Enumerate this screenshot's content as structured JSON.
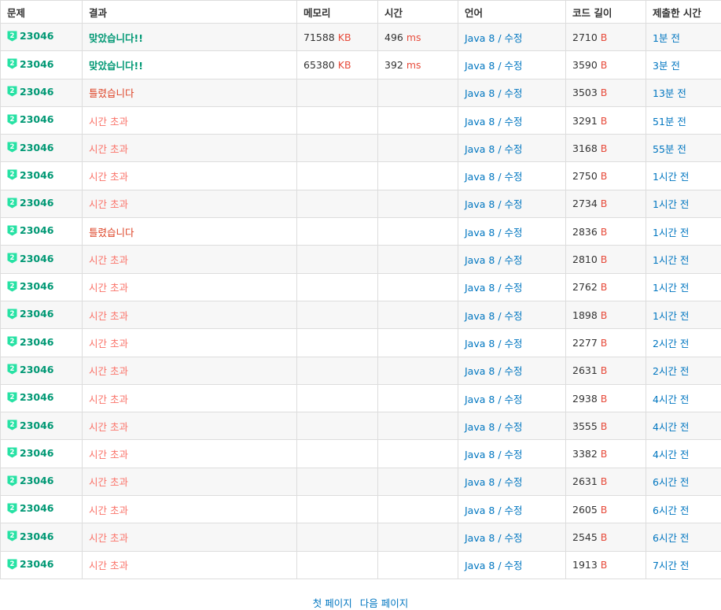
{
  "headers": [
    "문제",
    "결과",
    "메모리",
    "시간",
    "언어",
    "코드 길이",
    "제출한 시간"
  ],
  "units": {
    "memory": "KB",
    "time": "ms",
    "code": "B"
  },
  "language_separator": " / ",
  "tier_icon": {
    "name": "gold-tier-icon",
    "label": "2",
    "color": "#27e2a4"
  },
  "colors": {
    "accepted": "#009874",
    "wrong": "#dd4124",
    "tle": "#fa7268",
    "link": "#0076c0",
    "unit": "#e74c3c"
  },
  "rows": [
    {
      "problem": "23046",
      "result": "맞았습니다!!",
      "result_type": "ac",
      "memory": "71588",
      "time": "496",
      "language": "Java 8",
      "edit": "수정",
      "code_length": "2710",
      "submitted": "1분 전"
    },
    {
      "problem": "23046",
      "result": "맞았습니다!!",
      "result_type": "ac",
      "memory": "65380",
      "time": "392",
      "language": "Java 8",
      "edit": "수정",
      "code_length": "3590",
      "submitted": "3분 전"
    },
    {
      "problem": "23046",
      "result": "틀렸습니다",
      "result_type": "wa",
      "memory": "",
      "time": "",
      "language": "Java 8",
      "edit": "수정",
      "code_length": "3503",
      "submitted": "13분 전"
    },
    {
      "problem": "23046",
      "result": "시간 초과",
      "result_type": "tle",
      "memory": "",
      "time": "",
      "language": "Java 8",
      "edit": "수정",
      "code_length": "3291",
      "submitted": "51분 전"
    },
    {
      "problem": "23046",
      "result": "시간 초과",
      "result_type": "tle",
      "memory": "",
      "time": "",
      "language": "Java 8",
      "edit": "수정",
      "code_length": "3168",
      "submitted": "55분 전"
    },
    {
      "problem": "23046",
      "result": "시간 초과",
      "result_type": "tle",
      "memory": "",
      "time": "",
      "language": "Java 8",
      "edit": "수정",
      "code_length": "2750",
      "submitted": "1시간 전"
    },
    {
      "problem": "23046",
      "result": "시간 초과",
      "result_type": "tle",
      "memory": "",
      "time": "",
      "language": "Java 8",
      "edit": "수정",
      "code_length": "2734",
      "submitted": "1시간 전"
    },
    {
      "problem": "23046",
      "result": "틀렸습니다",
      "result_type": "wa",
      "memory": "",
      "time": "",
      "language": "Java 8",
      "edit": "수정",
      "code_length": "2836",
      "submitted": "1시간 전"
    },
    {
      "problem": "23046",
      "result": "시간 초과",
      "result_type": "tle",
      "memory": "",
      "time": "",
      "language": "Java 8",
      "edit": "수정",
      "code_length": "2810",
      "submitted": "1시간 전"
    },
    {
      "problem": "23046",
      "result": "시간 초과",
      "result_type": "tle",
      "memory": "",
      "time": "",
      "language": "Java 8",
      "edit": "수정",
      "code_length": "2762",
      "submitted": "1시간 전"
    },
    {
      "problem": "23046",
      "result": "시간 초과",
      "result_type": "tle",
      "memory": "",
      "time": "",
      "language": "Java 8",
      "edit": "수정",
      "code_length": "1898",
      "submitted": "1시간 전"
    },
    {
      "problem": "23046",
      "result": "시간 초과",
      "result_type": "tle",
      "memory": "",
      "time": "",
      "language": "Java 8",
      "edit": "수정",
      "code_length": "2277",
      "submitted": "2시간 전"
    },
    {
      "problem": "23046",
      "result": "시간 초과",
      "result_type": "tle",
      "memory": "",
      "time": "",
      "language": "Java 8",
      "edit": "수정",
      "code_length": "2631",
      "submitted": "2시간 전"
    },
    {
      "problem": "23046",
      "result": "시간 초과",
      "result_type": "tle",
      "memory": "",
      "time": "",
      "language": "Java 8",
      "edit": "수정",
      "code_length": "2938",
      "submitted": "4시간 전"
    },
    {
      "problem": "23046",
      "result": "시간 초과",
      "result_type": "tle",
      "memory": "",
      "time": "",
      "language": "Java 8",
      "edit": "수정",
      "code_length": "3555",
      "submitted": "4시간 전"
    },
    {
      "problem": "23046",
      "result": "시간 초과",
      "result_type": "tle",
      "memory": "",
      "time": "",
      "language": "Java 8",
      "edit": "수정",
      "code_length": "3382",
      "submitted": "4시간 전"
    },
    {
      "problem": "23046",
      "result": "시간 초과",
      "result_type": "tle",
      "memory": "",
      "time": "",
      "language": "Java 8",
      "edit": "수정",
      "code_length": "2631",
      "submitted": "6시간 전"
    },
    {
      "problem": "23046",
      "result": "시간 초과",
      "result_type": "tle",
      "memory": "",
      "time": "",
      "language": "Java 8",
      "edit": "수정",
      "code_length": "2605",
      "submitted": "6시간 전"
    },
    {
      "problem": "23046",
      "result": "시간 초과",
      "result_type": "tle",
      "memory": "",
      "time": "",
      "language": "Java 8",
      "edit": "수정",
      "code_length": "2545",
      "submitted": "6시간 전"
    },
    {
      "problem": "23046",
      "result": "시간 초과",
      "result_type": "tle",
      "memory": "",
      "time": "",
      "language": "Java 8",
      "edit": "수정",
      "code_length": "1913",
      "submitted": "7시간 전"
    }
  ],
  "pagination": {
    "first": "첫 페이지",
    "next": "다음 페이지"
  }
}
